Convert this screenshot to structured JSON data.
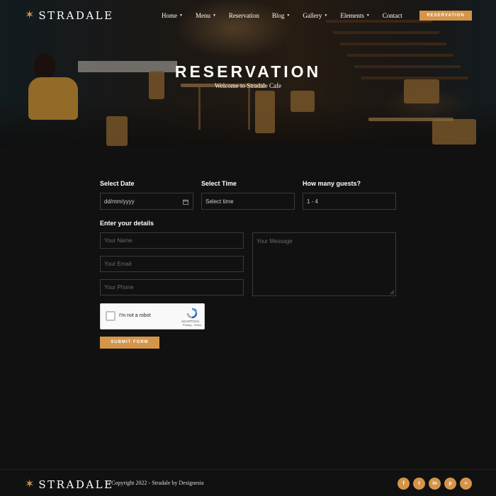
{
  "brand": {
    "name": "STRADALE",
    "logo_icon": "star-icon",
    "accent": "#d4954a"
  },
  "nav": {
    "items": [
      {
        "label": "Home",
        "dropdown": true
      },
      {
        "label": "Menu",
        "dropdown": true
      },
      {
        "label": "Reservation",
        "dropdown": false
      },
      {
        "label": "Blog",
        "dropdown": true
      },
      {
        "label": "Gallery",
        "dropdown": true
      },
      {
        "label": "Elements",
        "dropdown": true
      },
      {
        "label": "Contact",
        "dropdown": false
      }
    ],
    "cta": "RESERVATION"
  },
  "hero": {
    "title": "RESERVATION",
    "subtitle": "Welcome to Stradale Cafe"
  },
  "form": {
    "date": {
      "label": "Select Date",
      "value": "dd/mm/yyyy"
    },
    "time": {
      "label": "Select Time",
      "value": "Select time"
    },
    "guests": {
      "label": "How many guests?",
      "value": "1 - 4"
    },
    "details_label": "Enter your details",
    "name_placeholder": "Your Name",
    "email_placeholder": "Your Email",
    "phone_placeholder": "Your Phone",
    "message_placeholder": "Your Message",
    "captcha": {
      "label": "I'm not a robot",
      "brand": "reCAPTCHA",
      "links": "Privacy - Terms"
    },
    "submit": "SUBMIT FORM"
  },
  "footer": {
    "copyright": "© Copyright 2022 - Stradale by Designesia",
    "socials": [
      {
        "icon": "facebook-icon",
        "glyph": "f"
      },
      {
        "icon": "twitter-icon",
        "glyph": "t"
      },
      {
        "icon": "linkedin-icon",
        "glyph": "in"
      },
      {
        "icon": "pinterest-icon",
        "glyph": "p"
      },
      {
        "icon": "rss-icon",
        "glyph": "≈"
      }
    ]
  }
}
